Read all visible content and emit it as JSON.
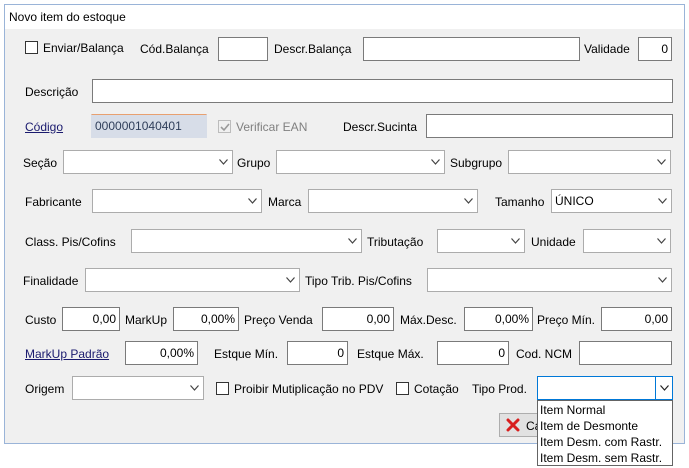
{
  "window": {
    "title": "Novo item do estoque"
  },
  "row1": {
    "enviar_balanca_label": "Enviar/Balança",
    "cod_balanca_label": "Cód.Balança",
    "cod_balanca_value": "",
    "descr_balanca_label": "Descr.Balança",
    "descr_balanca_value": "",
    "validade_label": "Validade",
    "validade_value": "0"
  },
  "descricao": {
    "label": "Descrição",
    "value": ""
  },
  "codigo": {
    "label": "Código",
    "value": "0000001040401",
    "verificar_ean_label": "Verificar EAN",
    "verificar_ean_checked": true,
    "descr_sucinta_label": "Descr.Sucinta",
    "descr_sucinta_value": ""
  },
  "secao": {
    "label": "Seção",
    "value": "",
    "grupo_label": "Grupo",
    "grupo_value": "",
    "subgrupo_label": "Subgrupo",
    "subgrupo_value": ""
  },
  "fabricante": {
    "label": "Fabricante",
    "value": "",
    "marca_label": "Marca",
    "marca_value": "",
    "tamanho_label": "Tamanho",
    "tamanho_value": "ÚNICO"
  },
  "classificacao": {
    "label": "Class. Pis/Cofins",
    "value": "",
    "tributacao_label": "Tributação",
    "tributacao_value": "",
    "unidade_label": "Unidade",
    "unidade_value": ""
  },
  "finalidade": {
    "label": "Finalidade",
    "value": "",
    "tipo_trib_label": "Tipo Trib. Pis/Cofins",
    "tipo_trib_value": ""
  },
  "precos": {
    "custo_label": "Custo",
    "custo_value": "0,00",
    "markup_label": "MarkUp",
    "markup_value": "0,00%",
    "preco_venda_label": "Preço Venda",
    "preco_venda_value": "0,00",
    "max_desc_label": "Máx.Desc.",
    "max_desc_value": "0,00%",
    "preco_min_label": "Preço Mín.",
    "preco_min_value": "0,00"
  },
  "markup_padrao": {
    "label": "MarkUp Padrão",
    "value": "0,00%",
    "estque_min_label": "Estque Mín.",
    "estque_min_value": "0",
    "estque_max_label": "Estque Máx.",
    "estque_max_value": "0",
    "cod_ncm_label": "Cod. NCM",
    "cod_ncm_value": ""
  },
  "origem": {
    "label": "Origem",
    "value": "",
    "proibir_label": "Proibir Mutiplicação no PDV",
    "cotacao_label": "Cotação",
    "tipo_prod_label": "Tipo Prod.",
    "tipo_prod_value": ""
  },
  "tipo_prod_options": [
    "Item Normal",
    "Item de Desmonte",
    "Item Desm. com Rastr.",
    "Item Desm. sem Rastr."
  ],
  "cancel_button": {
    "label": "Ca"
  },
  "colors": {
    "accent": "#0078d7",
    "cancel_icon": "#d81e1e",
    "link_text": "#1a1a6e"
  }
}
